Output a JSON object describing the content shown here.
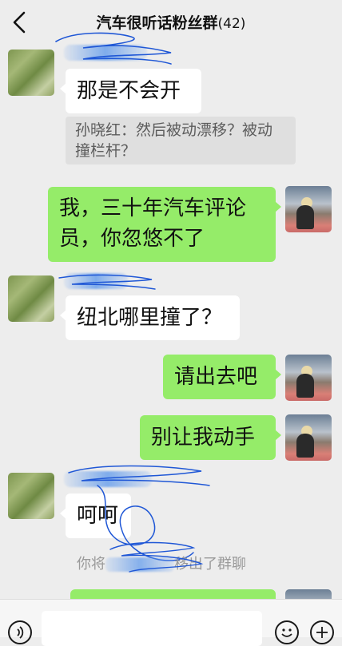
{
  "header": {
    "title": "汽车很听话粉丝群",
    "member_count": "(42)"
  },
  "messages": [
    {
      "text": "那是不会开",
      "quote": "孙晓红：然后被动漂移？被动撞栏杆？"
    },
    {
      "text": "我，三十年汽车评论员，你忽悠不了"
    },
    {
      "text": "纽北哪里撞了？"
    },
    {
      "text": "请出去吧"
    },
    {
      "text": "别让我动手"
    },
    {
      "text": "呵呵"
    }
  ],
  "system_notice": {
    "prefix": "你将",
    "suffix": "移出了群聊"
  },
  "colors": {
    "background": "#ededed",
    "bubble_self": "#95ec69",
    "bubble_other": "#ffffff",
    "scribble": "#1f57d6"
  },
  "icons": [
    "back-chevron-icon",
    "voice-icon",
    "emoji-icon",
    "plus-icon"
  ]
}
